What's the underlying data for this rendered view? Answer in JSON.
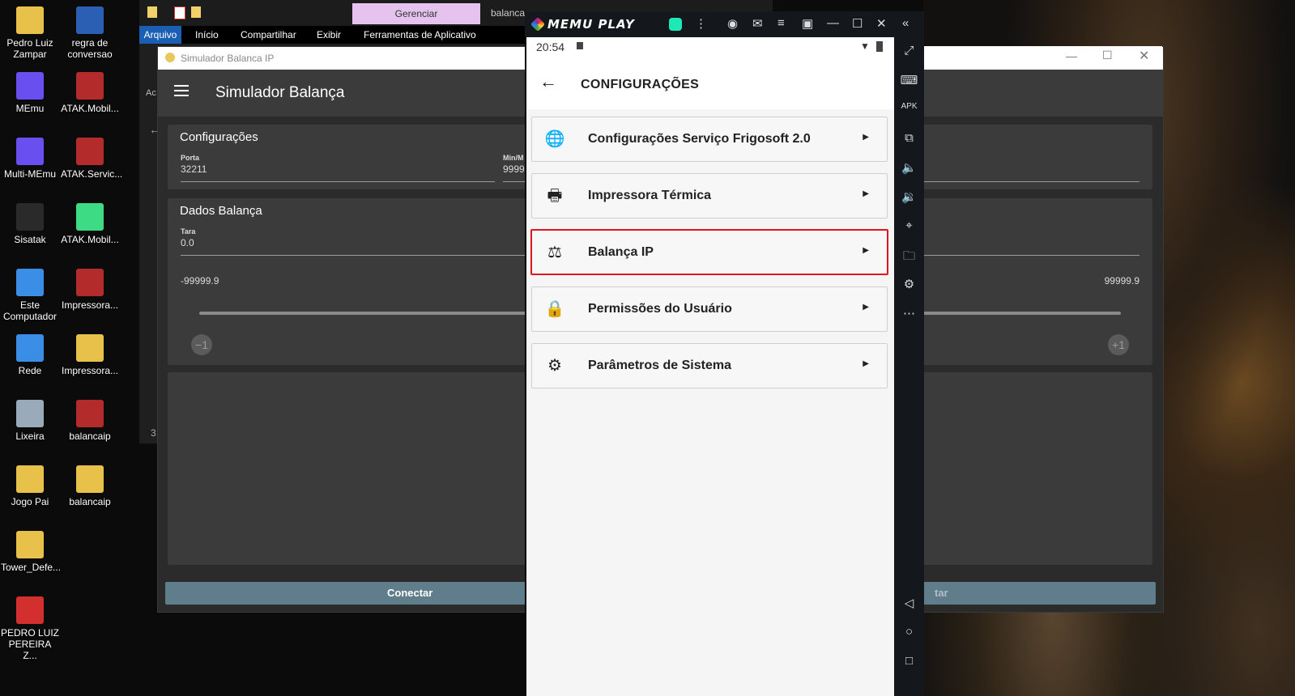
{
  "desktop": {
    "icons": [
      {
        "label": "Pedro Luiz Zampar",
        "icon": "user-folder-icon",
        "color": "#e8c14a"
      },
      {
        "label": "regra de conversao",
        "icon": "word-doc-icon",
        "color": "#2b5fb4"
      },
      {
        "label": "MEmu",
        "icon": "memu-icon",
        "color": "#6a4ff0"
      },
      {
        "label": "ATAK.Mobil...",
        "icon": "winrar-icon",
        "color": "#b42b2b"
      },
      {
        "label": "Multi-MEmu",
        "icon": "memu-icon",
        "color": "#6a4ff0"
      },
      {
        "label": "ATAK.Servic...",
        "icon": "winrar-icon",
        "color": "#b42b2b"
      },
      {
        "label": "Sisatak",
        "icon": "sisatak-icon",
        "color": "#2a2a2a"
      },
      {
        "label": "ATAK.Mobil...",
        "icon": "apk-icon",
        "color": "#3ddc84"
      },
      {
        "label": "Este Computador",
        "icon": "computer-icon",
        "color": "#3a8ee6"
      },
      {
        "label": "Impressora...",
        "icon": "winrar-icon",
        "color": "#b42b2b"
      },
      {
        "label": "Rede",
        "icon": "network-icon",
        "color": "#3a8ee6"
      },
      {
        "label": "Impressora...",
        "icon": "folder-icon",
        "color": "#e8c14a"
      },
      {
        "label": "Lixeira",
        "icon": "recycle-bin-icon",
        "color": "#9ab"
      },
      {
        "label": "balancaip",
        "icon": "winrar-icon",
        "color": "#b42b2b"
      },
      {
        "label": "Jogo Pai",
        "icon": "folder-icon",
        "color": "#e8c14a"
      },
      {
        "label": "balancaip",
        "icon": "folder-icon",
        "color": "#e8c14a"
      },
      {
        "label": "Tower_Defe...",
        "icon": "folder-icon",
        "color": "#e8c14a"
      },
      {
        "label": "PEDRO LUIZ PEREIRA Z...",
        "icon": "pdf-icon",
        "color": "#d32f2f"
      }
    ]
  },
  "explorer": {
    "context_tab": "Gerenciar",
    "path_fragment": "balanca",
    "tabs": [
      "Arquivo",
      "Início",
      "Compartilhar",
      "Exibir",
      "Ferramentas de Aplicativo"
    ],
    "left_fragment": "Ac",
    "count_fragment": "3"
  },
  "simulador": {
    "window_title": "Simulador Balanca IP",
    "app_title": "Simulador Balança",
    "config_card": {
      "title": "Configurações",
      "porta_label": "Porta",
      "porta_value": "32211",
      "minmax_label": "Min/M",
      "minmax_value": "9999"
    },
    "dados_card": {
      "title": "Dados Balança",
      "tara_label": "Tara",
      "tara_value": "0.0",
      "min_value": "-99999.9",
      "max_value": "99999.9",
      "minus_label": "−1",
      "plus_label": "+1"
    },
    "connect_label": "Conectar",
    "right_button_fragment": "tar"
  },
  "memu": {
    "brand": "MEMU PLAY",
    "phone": {
      "time": "20:54",
      "screen_title": "CONFIGURAÇÕES",
      "menu_items": [
        {
          "label": "Configurações Serviço Frigosoft 2.0",
          "icon": "globe-icon",
          "glyph": "🌐"
        },
        {
          "label": "Impressora Térmica",
          "icon": "printer-icon",
          "glyph": "🖶"
        },
        {
          "label": "Balança IP",
          "icon": "scale-icon",
          "glyph": "⚖"
        },
        {
          "label": "Permissões do Usuário",
          "icon": "lock-icon",
          "glyph": "🔒"
        },
        {
          "label": "Parâmetros de Sistema",
          "icon": "gear-icon",
          "glyph": "⚙"
        }
      ],
      "highlighted_item": "Balança IP",
      "highlight_color": "#e0141b"
    }
  }
}
